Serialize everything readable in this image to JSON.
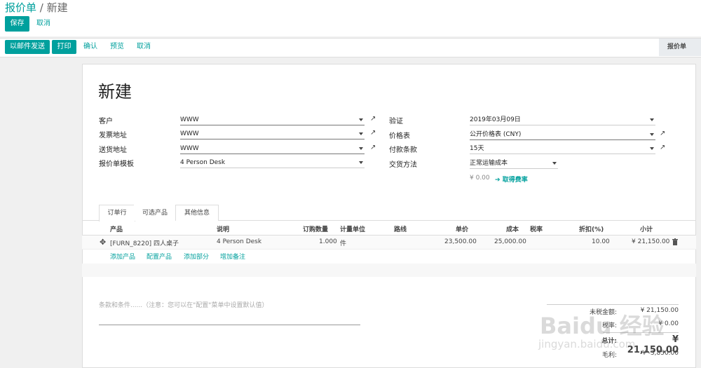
{
  "breadcrumb": {
    "parent": "报价单",
    "sep": "/",
    "current": "新建"
  },
  "top_buttons": {
    "save": "保存",
    "cancel": "取消"
  },
  "status_buttons": {
    "email": "以邮件发送",
    "print": "打印",
    "confirm": "确认",
    "preview": "预览",
    "cancel": "取消"
  },
  "stage": "报价单",
  "form": {
    "title": "新建",
    "left": [
      {
        "label": "客户",
        "value": "WWW"
      },
      {
        "label": "发票地址",
        "value": "WWW"
      },
      {
        "label": "送货地址",
        "value": "WWW"
      },
      {
        "label": "报价单模板",
        "value": "4 Person Desk"
      }
    ],
    "right": [
      {
        "label": "验证",
        "value": "2019年03月09日"
      },
      {
        "label": "价格表",
        "value": "公开价格表 (CNY)"
      },
      {
        "label": "付款条款",
        "value": "15天"
      },
      {
        "label": "交货方法",
        "value": "正常运输成本"
      }
    ],
    "shipping_cost": "¥ 0.00",
    "get_rate": "取得费率"
  },
  "tabs": [
    "订单行",
    "可选产品",
    "其他信息"
  ],
  "table": {
    "headers": [
      "产品",
      "说明",
      "订购数量",
      "计量单位",
      "路线",
      "单价",
      "成本",
      "税率",
      "折扣(%)",
      "小计"
    ],
    "row": {
      "product": "[FURN_8220] 四人桌子",
      "desc": "4 Person Desk",
      "qty": "1.000",
      "uom": "件",
      "route": "",
      "price": "23,500.00",
      "cost": "25,000.00",
      "tax": "",
      "discount": "10.00",
      "subtotal": "¥ 21,150.00"
    }
  },
  "add_links": [
    "添加产品",
    "配置产品",
    "添加部分",
    "增加备注"
  ],
  "terms_placeholder": "条款和条件......（注意：您可以在\"配置\"菜单中设置默认值）",
  "totals": [
    {
      "label": "未税金额:",
      "value": "¥ 21,150.00"
    },
    {
      "label": "税率:",
      "value": "¥ 0.00"
    },
    {
      "label": "总计:",
      "value": "¥ 21,150.00"
    },
    {
      "label": "毛利:",
      "value": "¥ -3,850.00"
    }
  ],
  "watermark": {
    "logo": "Baidu 经验",
    "url": "jingyan.baidu.com"
  }
}
